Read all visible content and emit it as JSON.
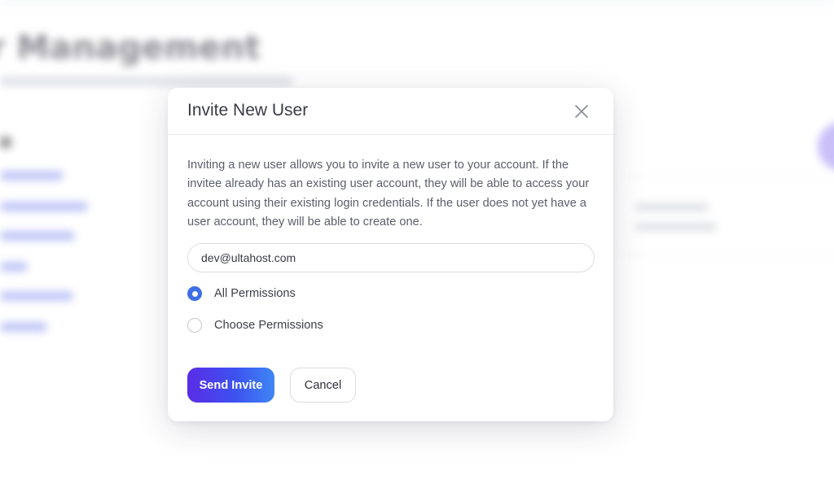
{
  "background": {
    "page_title": "r Management"
  },
  "modal": {
    "title": "Invite New User",
    "close_icon": "close-icon",
    "description": "Inviting a new user allows you to invite a new user to your account. If the invitee already has an existing user account, they will be able to access your account using their existing login credentials. If the user does not yet have a user account, they will be able to create one.",
    "email": {
      "value": "dev@ultahost.com",
      "placeholder": ""
    },
    "permissions": {
      "selected": "All Permissions",
      "options": [
        {
          "label": "All Permissions",
          "checked": true
        },
        {
          "label": "Choose Permissions",
          "checked": false
        }
      ]
    },
    "send_label": "Send Invite",
    "cancel_label": "Cancel"
  },
  "colors": {
    "accent": "#3e6fe6",
    "button_gradient_start": "#5a2ce6",
    "button_gradient_end": "#3f86f5",
    "text_primary": "#3a3b45",
    "text_secondary": "#5c5e6b"
  }
}
